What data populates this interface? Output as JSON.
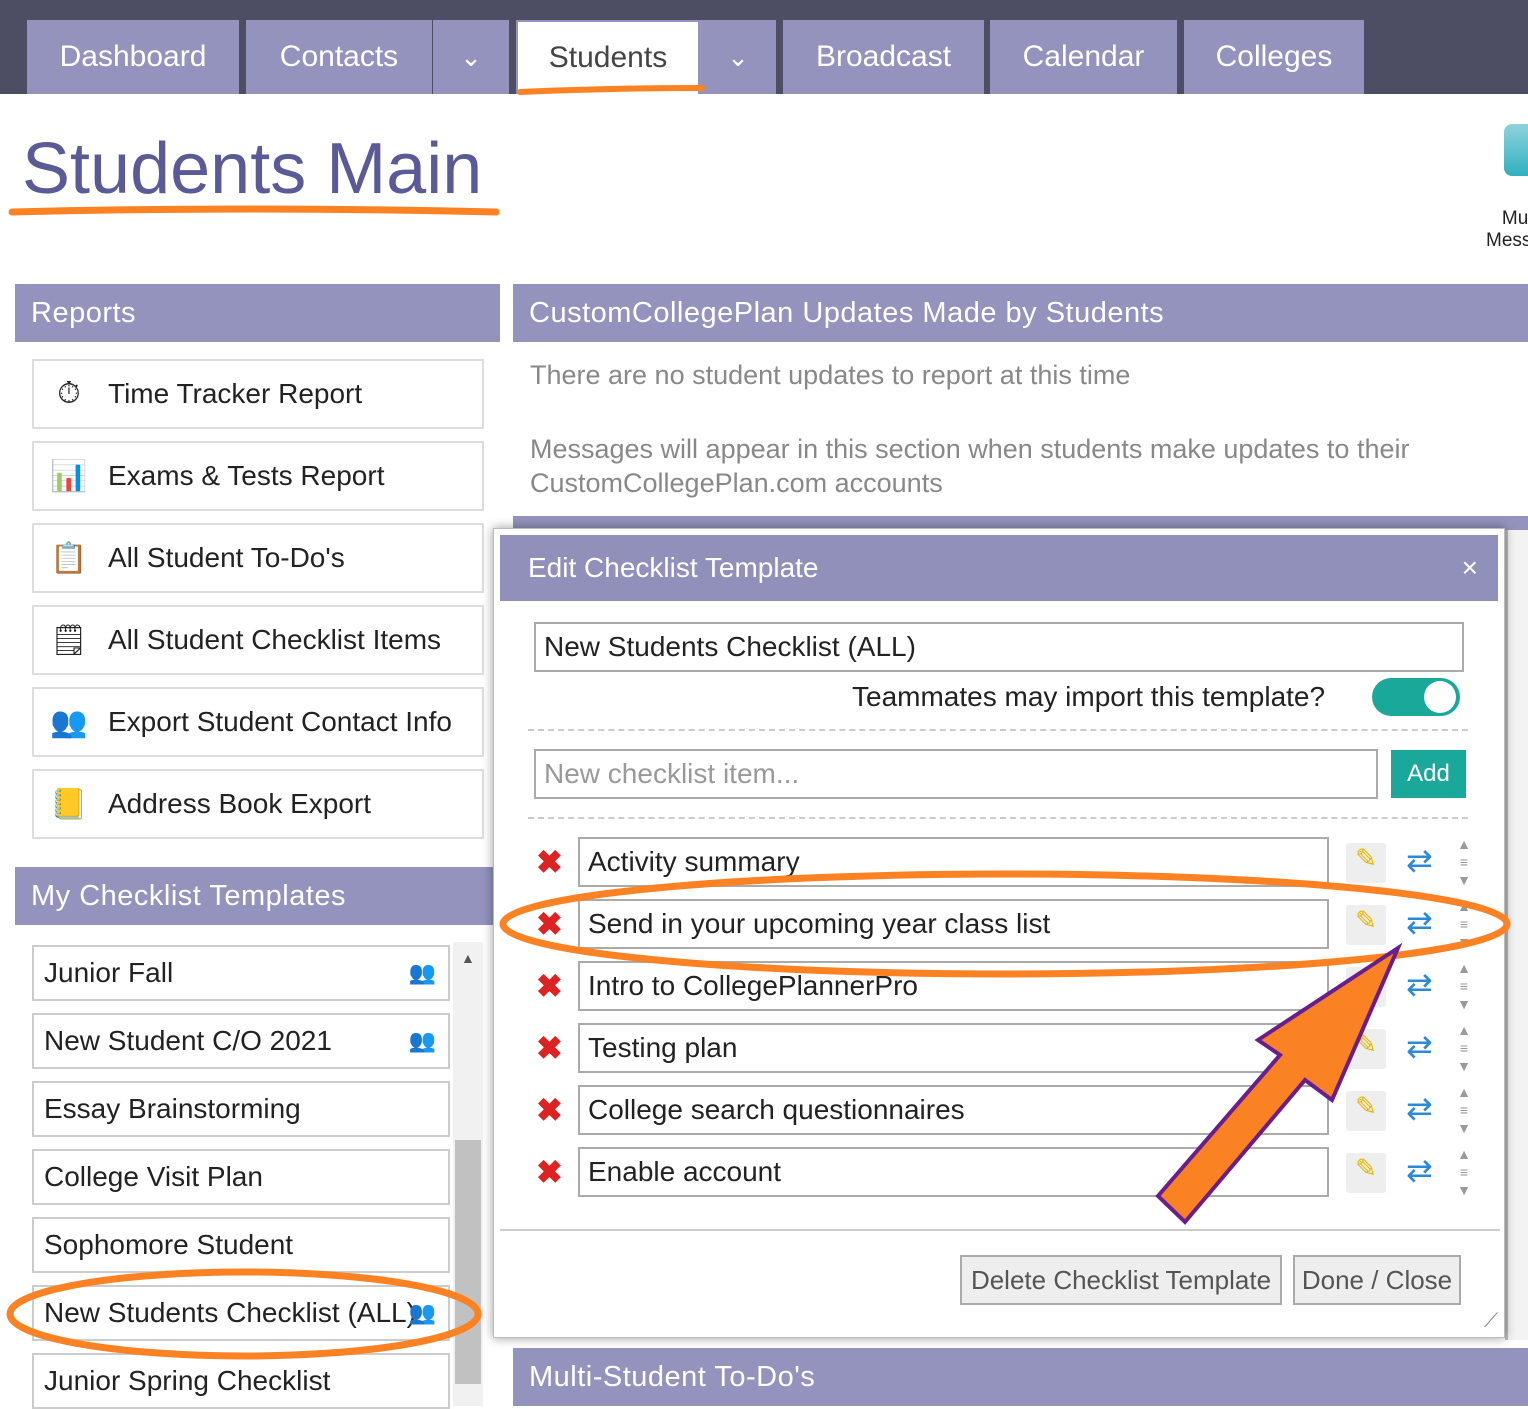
{
  "nav": {
    "tabs": [
      "Dashboard",
      "Contacts",
      "Students",
      "Broadcast",
      "Calendar",
      "Colleges"
    ],
    "active": "Students"
  },
  "page_title": "Students Main",
  "shortcut": {
    "label_line1": "Multi",
    "label_line2": "Messa"
  },
  "reports": {
    "title": "Reports",
    "items": [
      {
        "label": "Time Tracker Report",
        "icon": "stopwatch-icon"
      },
      {
        "label": "Exams & Tests Report",
        "icon": "bar-chart-icon"
      },
      {
        "label": "All Student To-Do's",
        "icon": "clipboard-icon"
      },
      {
        "label": "All Student Checklist Items",
        "icon": "notepad-icon"
      },
      {
        "label": "Export Student Contact Info",
        "icon": "people-icon"
      },
      {
        "label": "Address Book Export",
        "icon": "address-book-icon"
      }
    ]
  },
  "updates": {
    "title": "CustomCollegePlan Updates Made by Students",
    "line1": "There are no student updates to report at this time",
    "line2": "Messages will appear in this section when students make updates to their",
    "line3": "CustomCollegePlan.com accounts"
  },
  "templates": {
    "title": "My Checklist Templates",
    "items": [
      {
        "label": "Junior Fall",
        "shared": true
      },
      {
        "label": "New Student C/O 2021",
        "shared": true
      },
      {
        "label": "Essay Brainstorming",
        "shared": false
      },
      {
        "label": "College Visit Plan",
        "shared": false
      },
      {
        "label": "Sophomore Student",
        "shared": false
      },
      {
        "label": "New Students Checklist (ALL)",
        "shared": true
      },
      {
        "label": "Junior Spring Checklist",
        "shared": false
      }
    ]
  },
  "multi_todos": {
    "title": "Multi-Student To-Do's"
  },
  "modal": {
    "title": "Edit Checklist Template",
    "close": "×",
    "name_value": "New Students Checklist (ALL)",
    "import_label": "Teammates may import this template?",
    "import_enabled": true,
    "new_item_placeholder": "New checklist item...",
    "add_label": "Add",
    "items": [
      "Activity summary",
      "Send in your upcoming year class list",
      "Intro to CollegePlannerPro",
      "Testing plan",
      "College search questionnaires",
      "Enable account"
    ],
    "delete_label": "Delete Checklist Template",
    "done_label": "Done / Close"
  },
  "colors": {
    "nav_bg": "#4d4d63",
    "header": "#9393bd",
    "accent": "#1aa89a",
    "annotation": "#fb8223",
    "arrow_outline": "#6a1e8c"
  }
}
